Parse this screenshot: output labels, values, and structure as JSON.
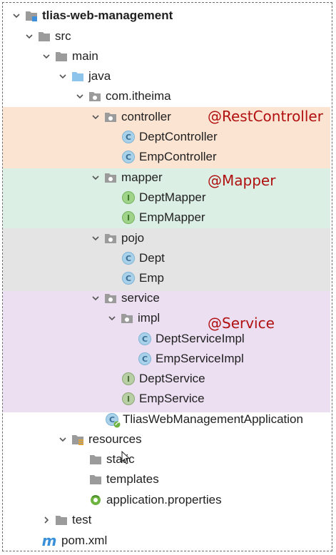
{
  "colors": {
    "controller_band": "#fce4d3",
    "mapper_band": "#dcefe4",
    "pojo_band": "#e4e4e4",
    "service_band": "#ecdff1",
    "annotation": "#b01010",
    "folder_blue": "#8cc4ec",
    "folder_grey": "#9b9b9b"
  },
  "tree": {
    "project": "tlias-web-management",
    "src": "src",
    "main": "main",
    "java": "java",
    "package": "com.itheima",
    "controller": "controller",
    "dept_controller": "DeptController",
    "emp_controller": "EmpController",
    "mapper": "mapper",
    "dept_mapper": "DeptMapper",
    "emp_mapper": "EmpMapper",
    "pojo": "pojo",
    "dept": "Dept",
    "emp": "Emp",
    "service": "service",
    "impl": "impl",
    "dept_service_impl": "DeptServiceImpl",
    "emp_service_impl": "EmpServiceImpl",
    "dept_service": "DeptService",
    "emp_service": "EmpService",
    "application": "TliasWebManagementApplication",
    "resources": "resources",
    "static": "static",
    "templates": "templates",
    "app_properties": "application.properties",
    "test": "test",
    "pom": "pom.xml"
  },
  "icons": {
    "class": "C",
    "interface": "I",
    "maven": "m"
  },
  "annotations": {
    "controller": "@RestController",
    "mapper": "@Mapper",
    "service": "@Service"
  }
}
